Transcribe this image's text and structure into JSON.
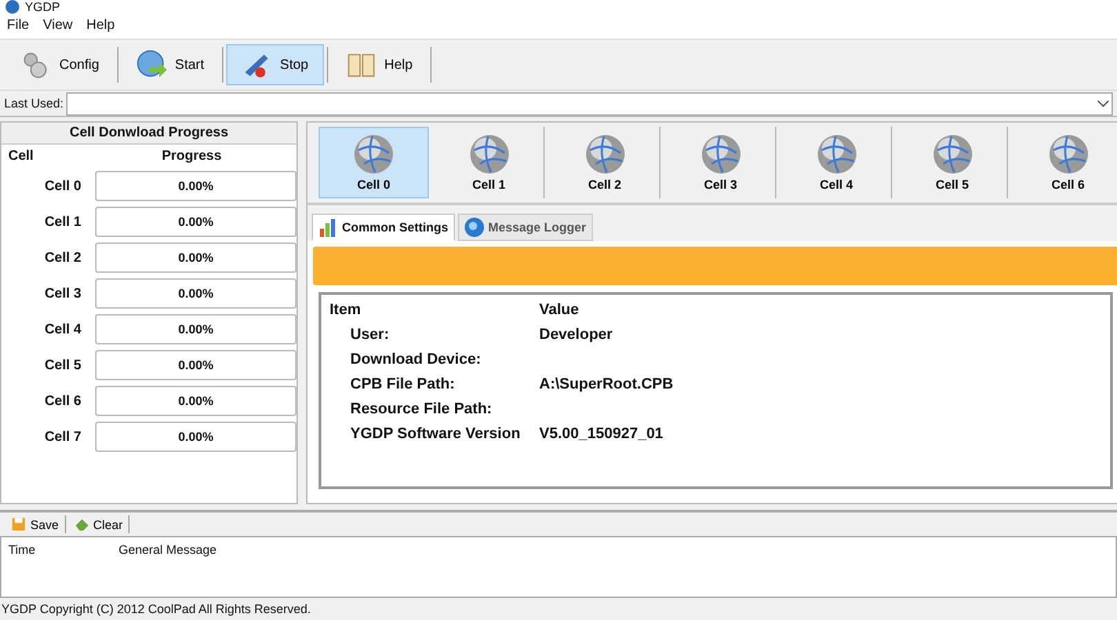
{
  "window": {
    "title": "YGDP"
  },
  "menu": [
    "File",
    "View",
    "Help"
  ],
  "toolbar": [
    {
      "label": "Config",
      "kind": "gears",
      "selected": false
    },
    {
      "label": "Start",
      "kind": "start",
      "selected": false
    },
    {
      "label": "Stop",
      "kind": "stop",
      "selected": true
    },
    {
      "label": "Help",
      "kind": "book",
      "selected": false
    }
  ],
  "last_used": {
    "label": "Last Used:"
  },
  "progress_panel": {
    "title": "Cell Donwload Progress",
    "columns": [
      "Cell",
      "Progress"
    ],
    "rows": [
      {
        "cell": "Cell 0",
        "progress": "0.00%",
        "level": 0
      },
      {
        "cell": "Cell 1",
        "progress": "0.00%",
        "level": 0
      },
      {
        "cell": "Cell 2",
        "progress": "0.00%",
        "level": 0
      },
      {
        "cell": "Cell 3",
        "progress": "0.00%",
        "level": 0
      },
      {
        "cell": "Cell 4",
        "progress": "0.00%",
        "level": 0
      },
      {
        "cell": "Cell 5",
        "progress": "0.00%",
        "level": 0
      },
      {
        "cell": "Cell 6",
        "progress": "0.00%",
        "level": 0
      },
      {
        "cell": "Cell 7",
        "progress": "0.00%",
        "level": 0
      }
    ]
  },
  "cells": [
    {
      "label": "Cell 0",
      "selected": true
    },
    {
      "label": "Cell 1",
      "selected": false
    },
    {
      "label": "Cell 2",
      "selected": false
    },
    {
      "label": "Cell 3",
      "selected": false
    },
    {
      "label": "Cell 4",
      "selected": false
    },
    {
      "label": "Cell 5",
      "selected": false
    },
    {
      "label": "Cell 6",
      "selected": false
    }
  ],
  "tabs": [
    {
      "label": "Common Settings",
      "kind": "chart",
      "selected": true
    },
    {
      "label": "Message Logger",
      "kind": "globe",
      "selected": false
    }
  ],
  "settings": {
    "columns": [
      "Item",
      "Value"
    ],
    "rows": [
      {
        "item": "User:",
        "value": "Developer"
      },
      {
        "item": "Download Device:",
        "value": ""
      },
      {
        "item": "CPB File Path:",
        "value": "A:\\SuperRoot.CPB"
      },
      {
        "item": "Resource File Path:",
        "value": ""
      },
      {
        "item": "YGDP Software Version",
        "value": "V5.00_150927_01"
      }
    ]
  },
  "log": {
    "buttons": [
      {
        "label": "Save",
        "kind": "save"
      },
      {
        "label": "Clear",
        "kind": "clear"
      }
    ],
    "columns": [
      "Time",
      "General Message"
    ]
  },
  "status_bar": "YGDP Copyright (C) 2012 CoolPad All Rights Reserved."
}
